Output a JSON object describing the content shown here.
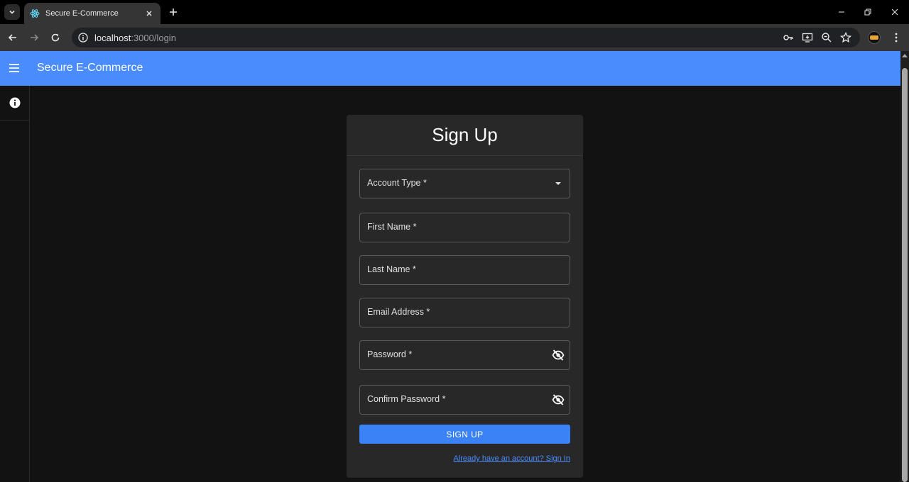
{
  "browser": {
    "tab_title": "Secure E-Commerce",
    "url_host": "localhost",
    "url_rest": ":3000/login",
    "icons": [
      "tab-search-icon",
      "react-favicon-icon",
      "close-icon",
      "plus-icon",
      "minimize-icon",
      "restore-icon",
      "close-window-icon",
      "back-icon",
      "forward-icon",
      "reload-icon",
      "site-info-icon",
      "key-icon",
      "install-app-icon",
      "zoom-icon",
      "star-icon",
      "extension-icon",
      "more-icon"
    ]
  },
  "appbar": {
    "title": "Secure E-Commerce",
    "color": "#4a8cfb"
  },
  "form": {
    "title": "Sign Up",
    "fields": {
      "account_type": "Account Type *",
      "first_name": "First Name *",
      "last_name": "Last Name *",
      "email": "Email Address *",
      "password": "Password *",
      "confirm_password": "Confirm Password *"
    },
    "submit_label": "SIGN UP",
    "signin_link": "Already have an account? Sign In",
    "accent_color": "#3b82f6"
  }
}
